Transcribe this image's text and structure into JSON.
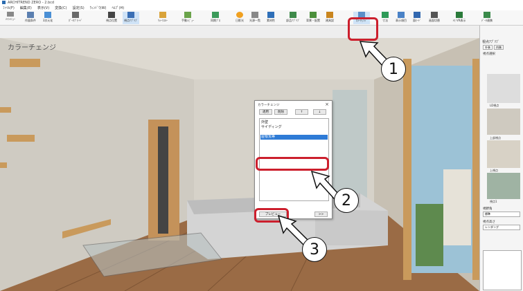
{
  "window": {
    "title": "ARCHITREND ZERO - 2.bcd"
  },
  "menu": [
    "ﾌｧｲﾙ(F)",
    "編集(E)",
    "表示(V)",
    "変換(C)",
    "設定(S)",
    "ｳｨﾝﾄﾞｳ(W)",
    "ﾍﾙﾌﾟ(H)"
  ],
  "ribbon": [
    "ﾒｲﾝﾒﾆｭｰ",
    "作図条件",
    "3次元化",
    "ﾎﾟｰﾀﾌﾞﾓｰﾄﾞ",
    "視点位置",
    "視点ｱﾌﾟﾘﾌﾞ",
    "ｳｫｰｸｽﾙｰ",
    "手動ﾚﾋﾞｭｰ",
    "同期ﾌﾟﾛ",
    "日影光",
    "光源一覧",
    "素材性",
    "部品ｱﾌﾟﾘﾌﾞ",
    "背景・配置",
    "建具設",
    "ｶﾗｰﾁｪﾝｼﾞ",
    "寸法",
    "表示項目",
    "面ﾓｰﾄﾞ",
    "画面切替",
    "ﾒﾓ VR表示",
    "ﾃﾞｰﾀ連携"
  ],
  "view": {
    "title": "カラーチェンジ"
  },
  "dialog": {
    "title": "カラーチェンジ",
    "buttons": {
      "apply": "適用",
      "delete": "削除",
      "up": "↑",
      "down": "↓"
    },
    "items": [
      "外壁",
      "サイディング",
      "",
      "屋根瓦等"
    ],
    "preview": "プレビュー",
    "more": ">>"
  },
  "right_panel": {
    "title": "視点ｱﾌﾟﾘﾌﾞ",
    "tab1": "外装",
    "tab2": "内装",
    "section": "視点選択",
    "thumb_labels": [
      "LD視点",
      "上部視点",
      "上視点",
      "視点1"
    ],
    "field1_label": "視野角",
    "field1_value": "標準",
    "field2_label": "視点高さ",
    "field2_value": "レンダング"
  },
  "callouts": {
    "one": "1",
    "two": "2",
    "three": "3"
  },
  "colors": {
    "accent_red": "#cc1f2d",
    "selection": "#2e7bd6"
  }
}
